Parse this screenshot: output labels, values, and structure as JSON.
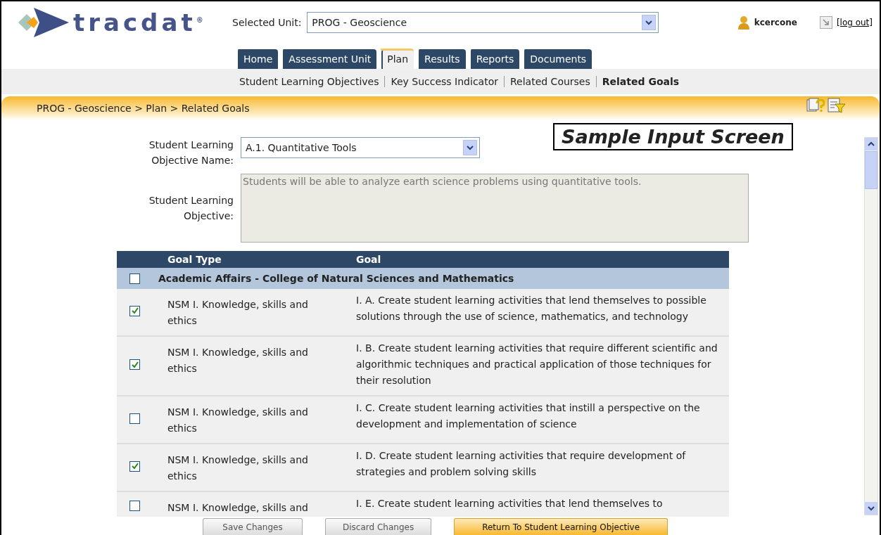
{
  "logo": {
    "text": "tracdat",
    "mark": "®"
  },
  "unit_selector": {
    "label": "Selected Unit:",
    "value": "PROG - Geoscience"
  },
  "user": {
    "name": "kcercone",
    "logout": "[log out]"
  },
  "tabs": [
    {
      "label": "Home",
      "selected": false
    },
    {
      "label": "Assessment Unit",
      "selected": false
    },
    {
      "label": "Plan",
      "selected": true
    },
    {
      "label": "Results",
      "selected": false
    },
    {
      "label": "Reports",
      "selected": false
    },
    {
      "label": "Documents",
      "selected": false
    }
  ],
  "subnav": [
    {
      "label": "Student Learning Objectives",
      "selected": false
    },
    {
      "label": "Key Success Indicator",
      "selected": false
    },
    {
      "label": "Related Courses",
      "selected": false
    },
    {
      "label": "Related Goals",
      "selected": true
    }
  ],
  "breadcrumb": "PROG - Geoscience > Plan > Related Goals",
  "overlay_caption": "Sample Input Screen",
  "form": {
    "name_label": "Student Learning Objective Name:",
    "name_value": "A.1. Quantitative Tools",
    "objective_label": "Student Learning Objective:",
    "objective_value": "Students will be able to analyze earth science problems using quantitative tools."
  },
  "table": {
    "columns": [
      "Goal Type",
      "Goal"
    ],
    "group": {
      "label": "Academic Affairs - College of Natural Sciences and Mathematics",
      "checked": false
    },
    "rows": [
      {
        "checked": true,
        "goal_type": "NSM I. Knowledge, skills and ethics",
        "goal": "I. A.  Create student learning activities that lend themselves to possible solutions through the use of science, mathematics, and technology"
      },
      {
        "checked": true,
        "goal_type": "NSM I. Knowledge, skills and ethics",
        "goal": "I. B.  Create student learning activities that require different scientific and algorithmic techniques and practical application of those techniques for their resolution"
      },
      {
        "checked": false,
        "goal_type": "NSM I. Knowledge, skills and ethics",
        "goal": "I. C. Create student learning activities that instill a perspective on the development and implementation of science"
      },
      {
        "checked": true,
        "goal_type": "NSM I. Knowledge, skills and ethics",
        "goal": "I. D. Create student learning activities that require development of strategies and problem solving skills"
      },
      {
        "checked": false,
        "goal_type": "NSM I. Knowledge, skills and",
        "goal": "I. E. Create student learning activities that lend themselves to"
      }
    ]
  },
  "buttons": [
    {
      "label": "Save Changes",
      "kind": "secondary"
    },
    {
      "label": "Discard Changes",
      "kind": "secondary"
    },
    {
      "label": "Return To Student Learning Objective",
      "kind": "primary"
    }
  ]
}
